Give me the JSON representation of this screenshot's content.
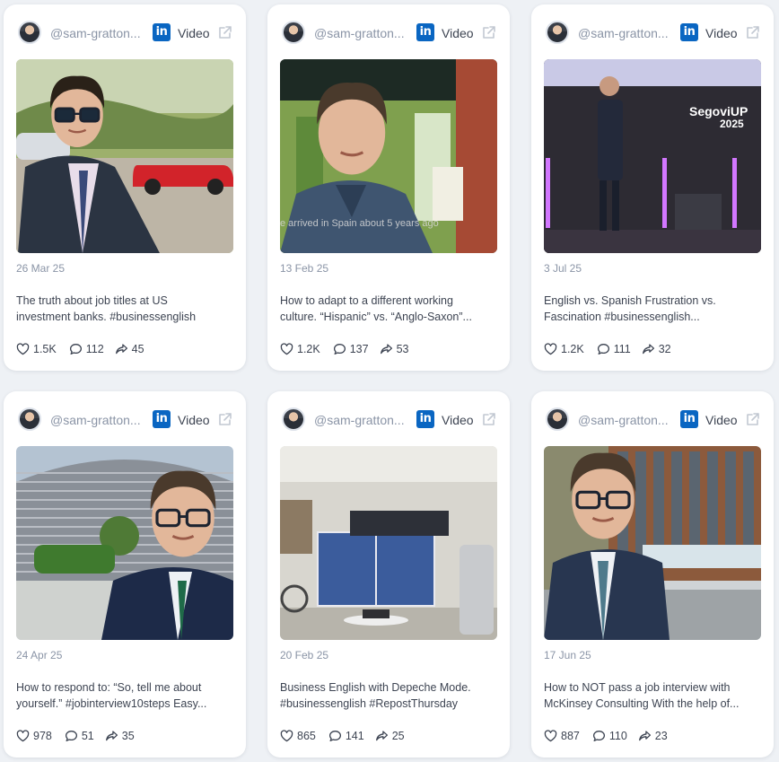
{
  "cards": [
    {
      "handle": "@sam-gratton...",
      "type": "Video",
      "date": "26 Mar 25",
      "caption": [
        "The truth about job titles at US",
        "investment banks. #businessenglish"
      ],
      "likes": "1.5K",
      "comments": "112",
      "shares": "45",
      "thumbnail_icon": "man-sunglasses-red-car"
    },
    {
      "handle": "@sam-gratton...",
      "type": "Video",
      "date": "13 Feb 25",
      "caption": [
        "How to adapt to a different working",
        "culture. “Hispanic” vs. “Anglo-Saxon”..."
      ],
      "likes": "1.2K",
      "comments": "137",
      "shares": "53",
      "thumbnail_icon": "man-selfie-shopfront",
      "overlay": "e arrived in Spain about 5 years ago"
    },
    {
      "handle": "@sam-gratton...",
      "type": "Video",
      "date": "3 Jul 25",
      "caption": [
        "English vs. Spanish Frustration vs.",
        "Fascination #businessenglish..."
      ],
      "likes": "1.2K",
      "comments": "111",
      "shares": "32",
      "thumbnail_icon": "speaker-on-stage",
      "stage_text": [
        "SegoviUP",
        "2025"
      ]
    },
    {
      "handle": "@sam-gratton...",
      "type": "Video",
      "date": "24 Apr 25",
      "caption": [
        "How to respond to: “So, tell me about",
        "yourself.” #jobinterview10steps Easy..."
      ],
      "likes": "978",
      "comments": "51",
      "shares": "35",
      "thumbnail_icon": "man-glasses-stadium"
    },
    {
      "handle": "@sam-gratton...",
      "type": "Video",
      "date": "20 Feb 25",
      "caption": [
        "Business English with Depeche Mode.",
        "#businessenglish #RepostThursday"
      ],
      "likes": "865",
      "comments": "141",
      "shares": "25",
      "thumbnail_icon": "garage-ping-pong-table"
    },
    {
      "handle": "@sam-gratton...",
      "type": "Video",
      "date": "17 Jun 25",
      "caption": [
        "How to NOT pass a job interview with",
        "McKinsey Consulting With the help of..."
      ],
      "likes": "887",
      "comments": "110",
      "shares": "23",
      "thumbnail_icon": "man-glasses-street"
    }
  ],
  "icons": {
    "linkedin": "in",
    "external": "external-link-icon",
    "like": "heart-icon",
    "comment": "comment-icon",
    "share": "share-icon"
  },
  "colors": {
    "linkedin_blue": "#0a66c2",
    "background": "#eef1f5",
    "text_muted": "#8a94a6",
    "text_main": "#3d4452"
  }
}
